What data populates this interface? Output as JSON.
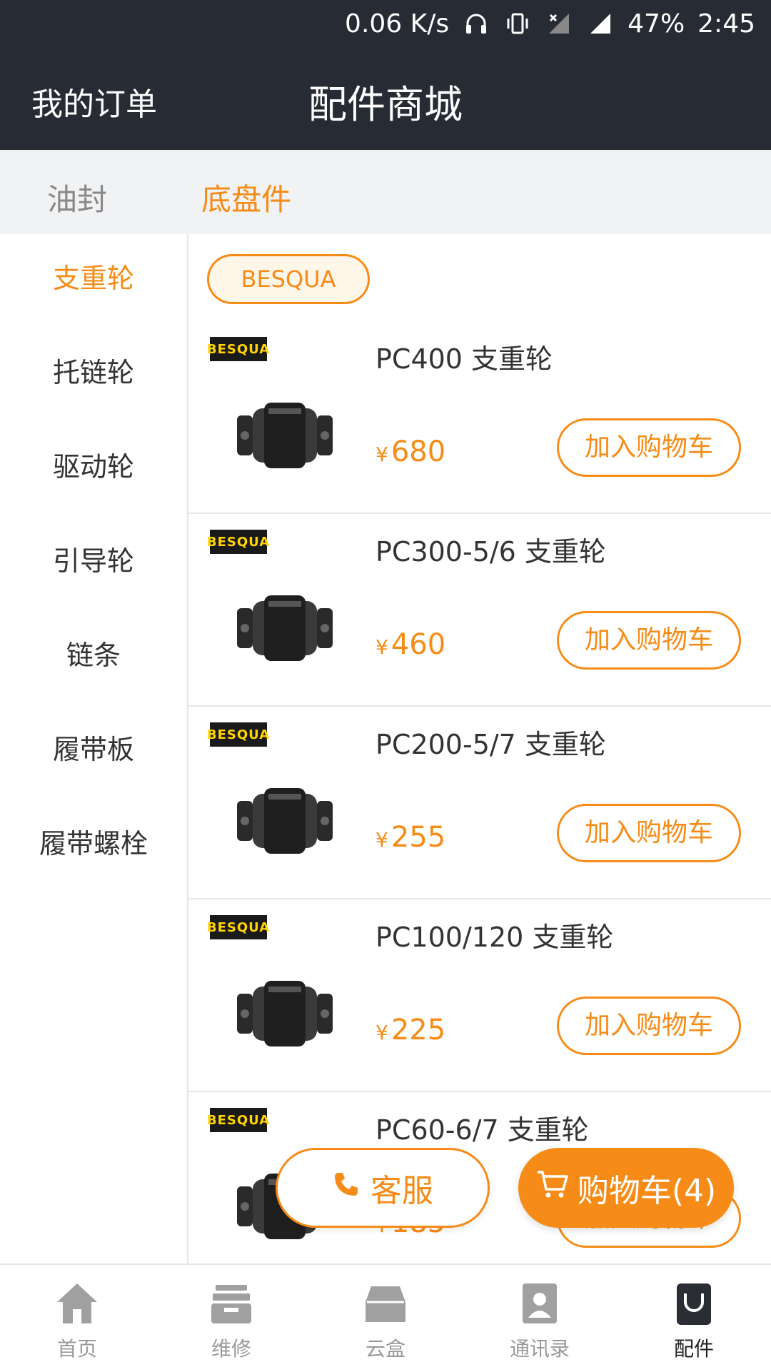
{
  "status_bar": {
    "speed": "0.06 K/s",
    "battery": "47%",
    "time": "2:45"
  },
  "header": {
    "orders_label": "我的订单",
    "title": "配件商城"
  },
  "category_tabs": [
    {
      "label": "油封",
      "active": false
    },
    {
      "label": "底盘件",
      "active": true
    }
  ],
  "sidebar": {
    "items": [
      {
        "label": "支重轮",
        "active": true
      },
      {
        "label": "托链轮",
        "active": false
      },
      {
        "label": "驱动轮",
        "active": false
      },
      {
        "label": "引导轮",
        "active": false
      },
      {
        "label": "链条",
        "active": false
      },
      {
        "label": "履带板",
        "active": false
      },
      {
        "label": "履带螺栓",
        "active": false
      }
    ]
  },
  "brand_filter": "BESQUA",
  "brand_logo_text": "BESQUA",
  "currency_symbol": "¥",
  "add_to_cart_label": "加入购物车",
  "products": [
    {
      "name": "PC400 支重轮",
      "price": "680"
    },
    {
      "name": "PC300-5/6 支重轮",
      "price": "460"
    },
    {
      "name": "PC200-5/7 支重轮",
      "price": "255"
    },
    {
      "name": "PC100/120 支重轮",
      "price": "225"
    },
    {
      "name": "PC60-6/7 支重轮",
      "price": "185"
    }
  ],
  "floating": {
    "customer_service": "客服",
    "cart": "购物车(4)"
  },
  "bottom_nav": [
    {
      "label": "首页",
      "icon": "home-icon",
      "active": false
    },
    {
      "label": "维修",
      "icon": "repair-icon",
      "active": false
    },
    {
      "label": "云盒",
      "icon": "cloud-box-icon",
      "active": false
    },
    {
      "label": "通讯录",
      "icon": "contacts-icon",
      "active": false
    },
    {
      "label": "配件",
      "icon": "parts-bag-icon",
      "active": true
    }
  ],
  "colors": {
    "accent": "#f78b17",
    "header_bg": "#272b33",
    "tab_bg": "#f1f2f4"
  }
}
